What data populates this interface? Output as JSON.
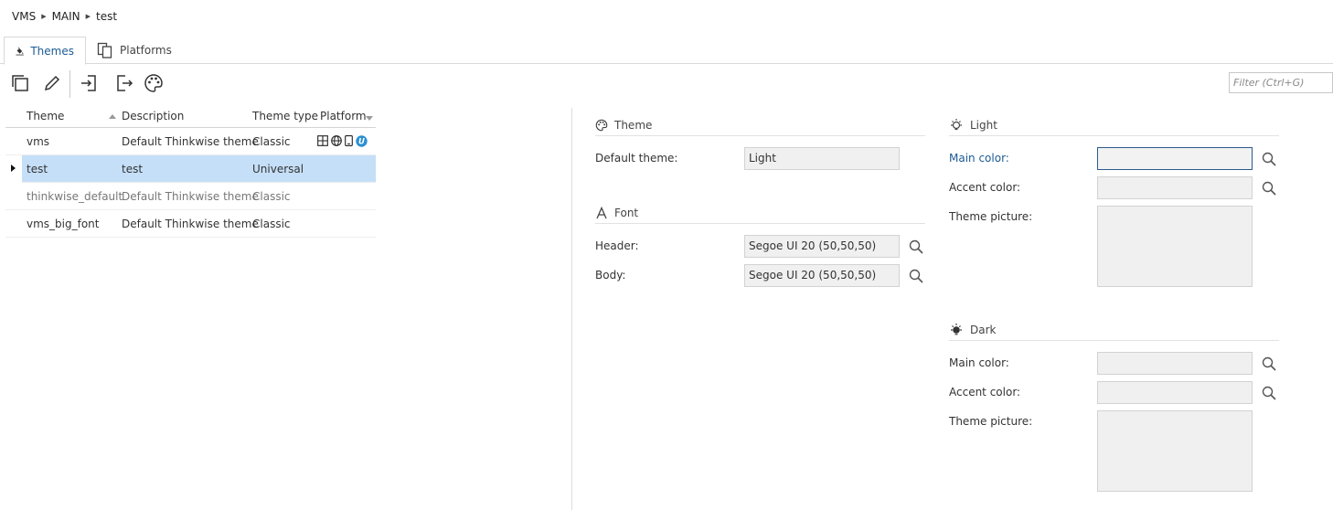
{
  "breadcrumb": [
    "VMS",
    "MAIN",
    "test"
  ],
  "tabs": [
    {
      "label": "Themes",
      "active": true
    },
    {
      "label": "Platforms",
      "active": false
    }
  ],
  "toolbar": {
    "buttons": [
      "copy-icon",
      "edit-icon",
      "import-icon",
      "export-icon",
      "palette-icon"
    ]
  },
  "filter": {
    "placeholder": "Filter (Ctrl+G)"
  },
  "grid": {
    "columns": [
      "Theme",
      "Description",
      "Theme type",
      "Platform"
    ],
    "rows": [
      {
        "theme": "vms",
        "description": "Default Thinkwise theme",
        "type": "Classic",
        "platform_icons": [
          "windows-icon",
          "web-icon",
          "mobile-icon",
          "universal-icon"
        ]
      },
      {
        "theme": "test",
        "description": "test",
        "type": "Universal",
        "selected": true
      },
      {
        "theme": "thinkwise_default",
        "description": "Default Thinkwise theme",
        "type": "Classic"
      },
      {
        "theme": "vms_big_font",
        "description": "Default Thinkwise theme",
        "type": "Classic"
      }
    ]
  },
  "form": {
    "theme": {
      "title": "Theme",
      "default_theme_label": "Default theme:",
      "default_theme_value": "Light"
    },
    "font": {
      "title": "Font",
      "header_label": "Header:",
      "header_value": "Segoe UI 20 (50,50,50)",
      "body_label": "Body:",
      "body_value": "Segoe UI 20 (50,50,50)"
    },
    "light": {
      "title": "Light",
      "main_color_label": "Main color:",
      "accent_color_label": "Accent color:",
      "theme_picture_label": "Theme picture:"
    },
    "dark": {
      "title": "Dark",
      "main_color_label": "Main color:",
      "accent_color_label": "Accent color:",
      "theme_picture_label": "Theme picture:"
    }
  },
  "colors": {
    "accent": "#1c5b95",
    "selection": "#c5dff8"
  }
}
